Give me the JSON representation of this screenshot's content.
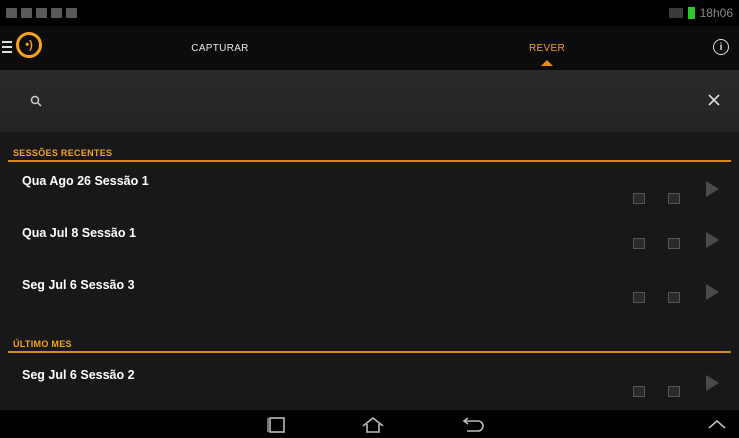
{
  "status": {
    "time": "18h06",
    "battery_color": "#2ec82e"
  },
  "header": {
    "logo_icon": "capture-logo-icon",
    "tabs": [
      {
        "label": "CAPTURAR",
        "active": false
      },
      {
        "label": "REVER",
        "active": true
      }
    ],
    "accent": "#f5a31a"
  },
  "search": {
    "value": "",
    "placeholder": ""
  },
  "sections": [
    {
      "title": "SESSÕES RECENTES",
      "items": [
        {
          "title": "Qua Ago 26 Sessão 1"
        },
        {
          "title": "Qua Jul 8 Sessão 1"
        },
        {
          "title": "Seg Jul 6 Sessão 3"
        }
      ]
    },
    {
      "title": "ÚLTIMO MES",
      "items": [
        {
          "title": "Seg Jul 6 Sessão 2"
        }
      ]
    }
  ]
}
